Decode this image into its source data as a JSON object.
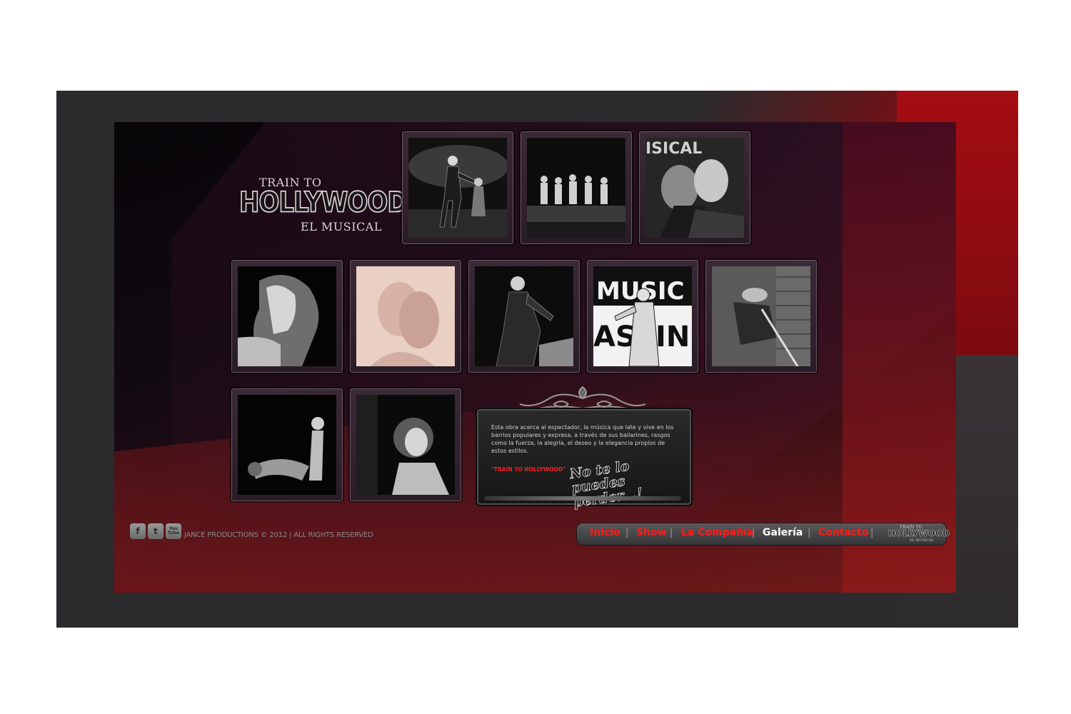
{
  "logo": {
    "line1": "TRAIN TO",
    "line2": "HOLLYWOOD",
    "line3": "EL MUSICAL"
  },
  "gallery": {
    "photos": [
      {
        "name": "photo-dancer-stage-1"
      },
      {
        "name": "photo-group-stage"
      },
      {
        "name": "photo-couple-kiss"
      },
      {
        "name": "photo-dancer-hair"
      },
      {
        "name": "photo-couple-dance-faded"
      },
      {
        "name": "photo-man-dancing"
      },
      {
        "name": "photo-music-casting"
      },
      {
        "name": "photo-man-cap-brick"
      },
      {
        "name": "photo-couple-dip"
      },
      {
        "name": "photo-woman-curly"
      }
    ],
    "photo_signs": {
      "music": "MUSIC",
      "casting": "ASTIN",
      "sign3": "ISICAL"
    }
  },
  "info": {
    "description": "Esta obra acerca al espectador, la música que late y vive en los barrios populares y expresa, a través de sus bailarines, rasgos como la fuerza, la alegría, el deseo y la elegancia propios de estos estilos.",
    "tag": "\"TRAIN TO HOLLYWOOD\"",
    "slogan": "No te lo puedes perder...!"
  },
  "footer": {
    "social": [
      {
        "name": "facebook-icon",
        "glyph": "f"
      },
      {
        "name": "twitter-icon",
        "glyph": "t"
      },
      {
        "name": "youtube-icon",
        "glyph": "You\nTube"
      }
    ],
    "copyright": "JANCE PRODUCTIONS © 2012 | ALL RIGHTS RESERVED"
  },
  "nav": {
    "items": [
      {
        "label": "Inicio",
        "active": false
      },
      {
        "label": "Show",
        "active": false
      },
      {
        "label": "La Compañía",
        "active": false
      },
      {
        "label": "Galería",
        "active": true
      },
      {
        "label": "Contacto",
        "active": false
      }
    ],
    "separator": "|",
    "mini_logo": {
      "line1": "TRAIN TO",
      "line2": "HOLLYWOOD",
      "line3": "EL MUSICAL"
    }
  },
  "colors": {
    "accent_red": "#ff1a1a",
    "background_dark": "#2b2a2c",
    "active_nav": "#ffffff"
  }
}
